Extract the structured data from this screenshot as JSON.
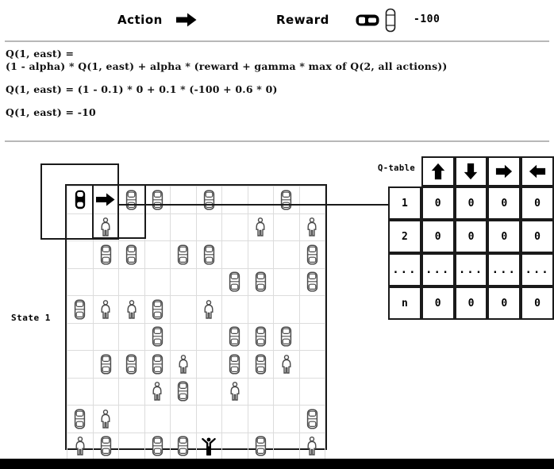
{
  "header": {
    "action_label": "Action",
    "action_icon": "right-arrow-icon",
    "reward_label": "Reward",
    "reward_car_icon": "black-car-icon",
    "reward_pedestrian_icon": "pedestrian-icon",
    "reward_value": "-100"
  },
  "equations": [
    "Q(1, east) =",
    "(1 - alpha) * Q(1, east) + alpha * (reward + gamma * max of Q(2, all actions))",
    "",
    "Q(1, east) = (1 - 0.1) * 0 + 0.1 * (-100 + 0.6 * 0)",
    "",
    "Q(1, east) = -10"
  ],
  "callout": {
    "state_label": "State 1"
  },
  "qtable": {
    "title": "Q-table",
    "action_headers": [
      "up-arrow-icon",
      "down-arrow-icon",
      "right-arrow-icon",
      "left-arrow-icon"
    ],
    "rows": [
      {
        "state": "1",
        "values": [
          "0",
          "0",
          "0",
          "0"
        ]
      },
      {
        "state": "2",
        "values": [
          "0",
          "0",
          "0",
          "0"
        ]
      },
      {
        "state": "...",
        "values": [
          "...",
          "...",
          "...",
          "..."
        ]
      },
      {
        "state": "n",
        "values": [
          "0",
          "0",
          "0",
          "0"
        ]
      }
    ]
  },
  "gridworld": {
    "rows": 10,
    "cols": 10,
    "legend": {
      "agent": "black-car-agent-icon",
      "car": "car-icon",
      "pedestrian": "pedestrian-icon",
      "goal": "goal-person-icon",
      "action_arrow": "right-arrow-icon"
    },
    "cells": [
      [
        "agent",
        "arrow",
        "car",
        "car",
        "",
        "car",
        "",
        "",
        "car",
        ""
      ],
      [
        "",
        "ped",
        "",
        "",
        "",
        "",
        "",
        "ped",
        "",
        "ped"
      ],
      [
        "",
        "car",
        "car",
        "",
        "car",
        "car",
        "",
        "",
        "",
        "car"
      ],
      [
        "",
        "",
        "",
        "",
        "",
        "",
        "car",
        "car",
        "",
        "car"
      ],
      [
        "car",
        "ped",
        "ped",
        "car",
        "",
        "ped",
        "",
        "",
        "",
        ""
      ],
      [
        "",
        "",
        "",
        "car",
        "",
        "",
        "car",
        "car",
        "car",
        ""
      ],
      [
        "",
        "car",
        "car",
        "car",
        "ped",
        "",
        "car",
        "car",
        "ped",
        ""
      ],
      [
        "",
        "",
        "",
        "ped",
        "car",
        "",
        "ped",
        "",
        "",
        ""
      ],
      [
        "car",
        "ped",
        "",
        "",
        "",
        "",
        "",
        "",
        "",
        "car"
      ],
      [
        "ped",
        "car",
        "",
        "car",
        "car",
        "goal",
        "",
        "car",
        "",
        "ped"
      ]
    ]
  },
  "colors": {
    "ink": "#1a1a1a",
    "grid_line": "#dcdcdc",
    "divider": "#b8b8b8",
    "bottom_bar": "#000000",
    "background": "#ffffff"
  }
}
